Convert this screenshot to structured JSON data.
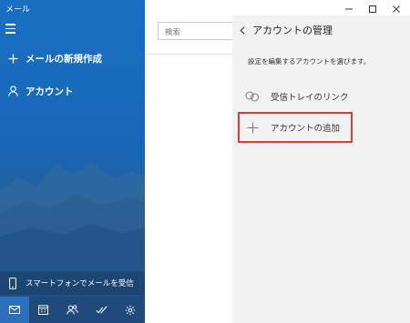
{
  "app": {
    "title": "メール"
  },
  "nav": {
    "new_mail_label": "メールの新規作成",
    "accounts_label": "アカウント",
    "phone_promo_label": "スマートフォンでメールを受信",
    "bottom_icons": [
      "mail-icon",
      "calendar-icon",
      "people-icon",
      "todo-icon",
      "settings-icon"
    ]
  },
  "search": {
    "placeholder": "検索"
  },
  "panel": {
    "title": "アカウントの管理",
    "description": "設定を編集するアカウントを選びます。",
    "items": [
      {
        "label": "受信トレイのリンク",
        "icon": "link-icon"
      },
      {
        "label": "アカウントの追加",
        "icon": "plus-icon"
      }
    ]
  },
  "colors": {
    "nav_blue": "#1a6fc3",
    "nav_bottom": "#1e4a7c",
    "panel_bg": "#f2f2f2",
    "highlight": "#e53935"
  }
}
